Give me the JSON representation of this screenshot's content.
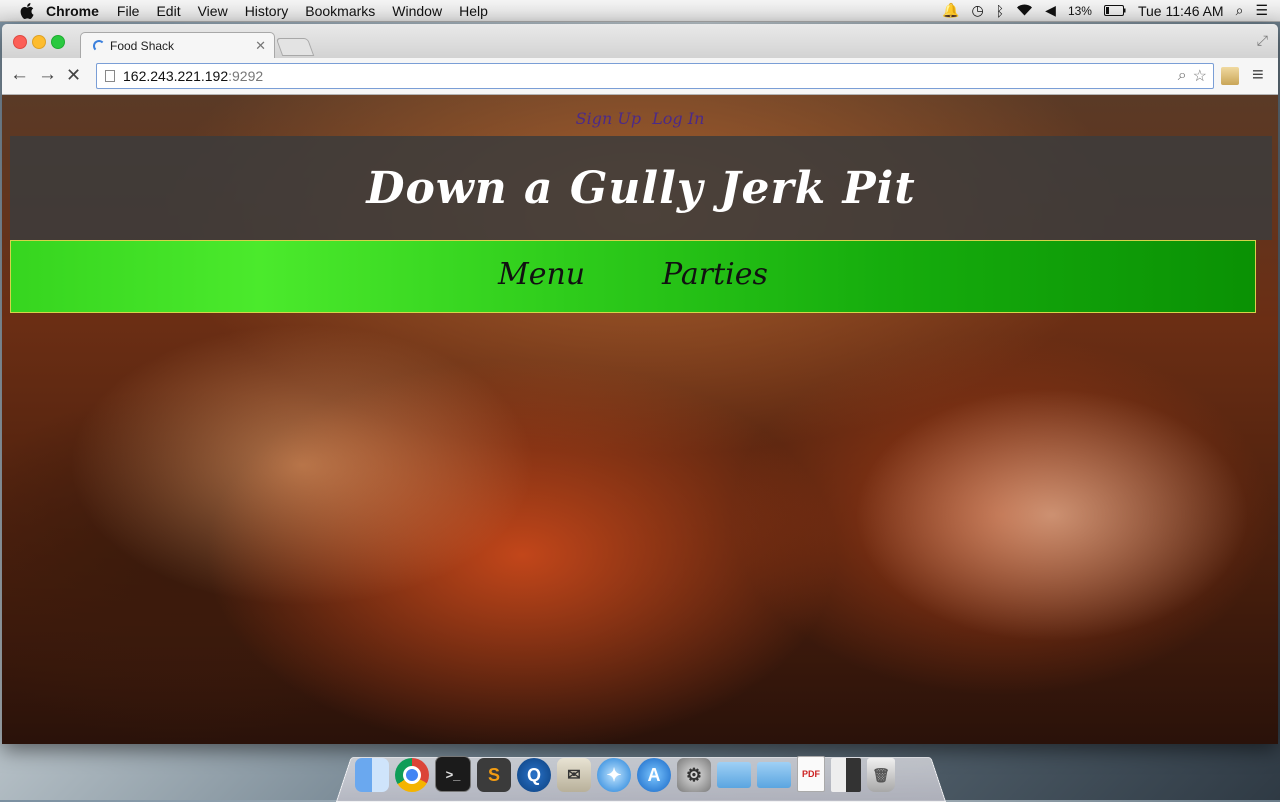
{
  "menubar": {
    "app_name": "Chrome",
    "items": [
      "File",
      "Edit",
      "View",
      "History",
      "Bookmarks",
      "Window",
      "Help"
    ],
    "battery_percent": "13%",
    "clock": "Tue 11:46 AM"
  },
  "browser": {
    "tab_title": "Food Shack",
    "url_host": "162.243.221.192",
    "url_port": ":9292"
  },
  "page": {
    "auth": {
      "sign_up": "Sign Up",
      "log_in": "Log In"
    },
    "title": "Down a Gully Jerk Pit",
    "nav": {
      "menu": "Menu",
      "parties": "Parties"
    }
  },
  "dock": {
    "pdf_label": "PDF"
  }
}
